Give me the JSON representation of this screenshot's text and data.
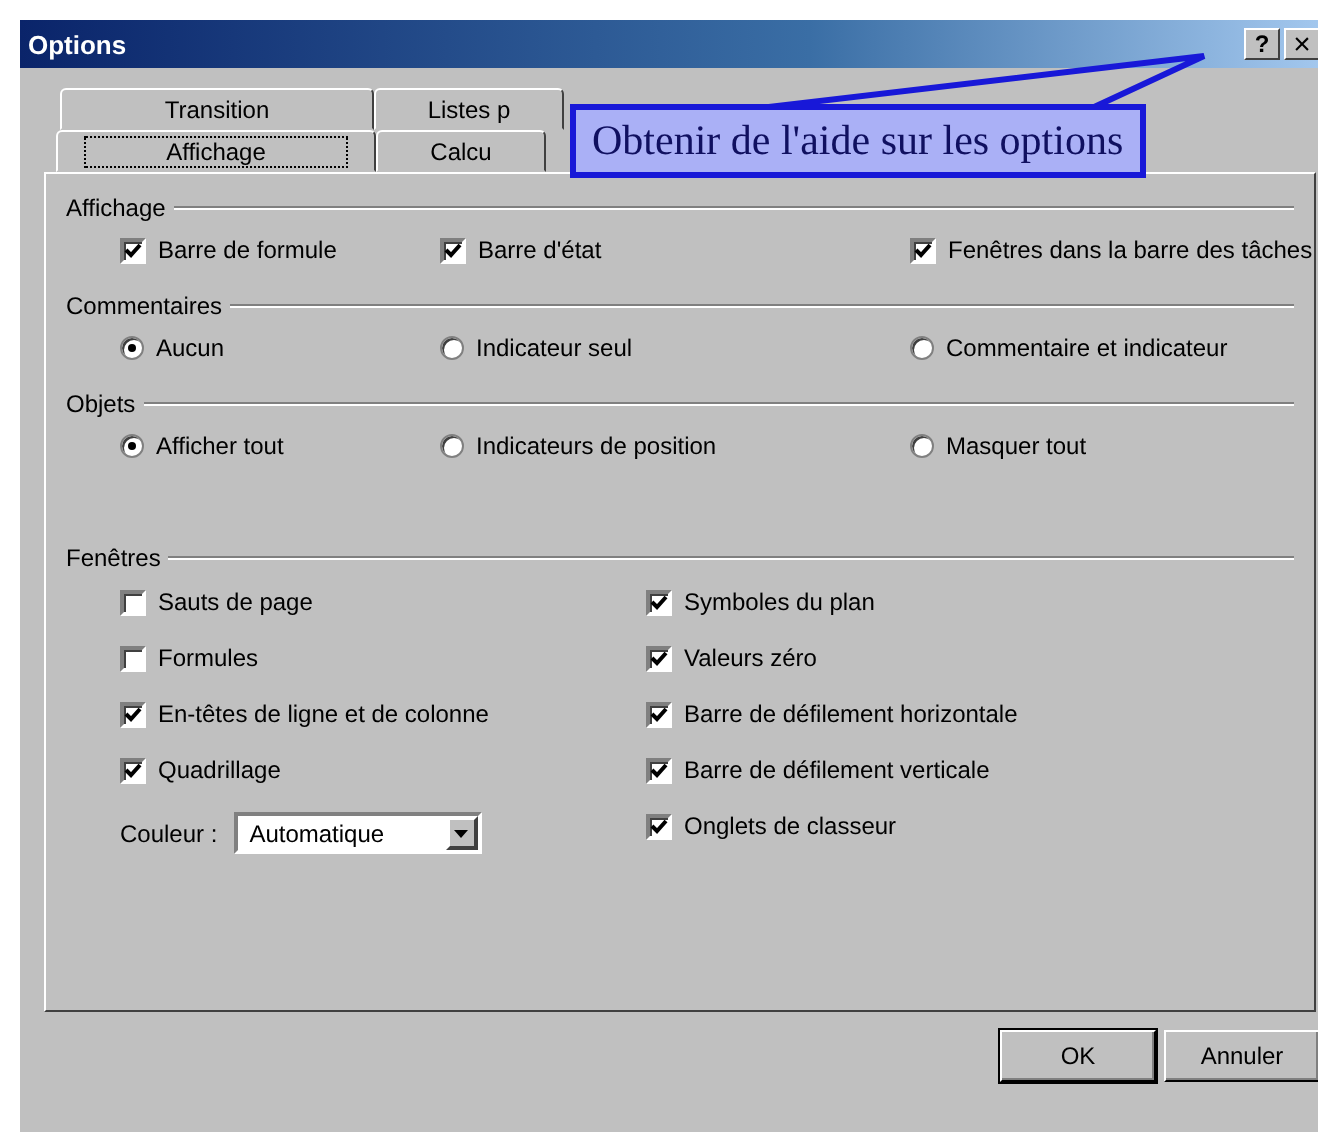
{
  "window": {
    "title": "Options",
    "controls": [
      {
        "kind": "help",
        "label": "?"
      },
      {
        "kind": "close",
        "label": "×"
      }
    ]
  },
  "callout": {
    "text": "Obtenir de l'aide sur les options"
  },
  "tab_rows": [
    [
      {
        "label": "Transition",
        "selected": false
      },
      {
        "label": "Listes p",
        "selected": false
      }
    ],
    [
      {
        "label": "Affichage",
        "selected": true
      },
      {
        "label": "Calcu",
        "selected": false
      }
    ]
  ],
  "sections": [
    {
      "kind": "checks",
      "title": "Affichage",
      "items": [
        {
          "label": "Barre de formule",
          "checked": true
        },
        {
          "label": "Barre d'état",
          "checked": true
        },
        {
          "label": "Fenêtres dans la barre des tâches",
          "checked": true
        }
      ]
    },
    {
      "kind": "radios",
      "title": "Commentaires",
      "items": [
        {
          "label": "Aucun",
          "selected": true
        },
        {
          "label": "Indicateur seul",
          "selected": false
        },
        {
          "label": "Commentaire et indicateur",
          "selected": false
        }
      ]
    },
    {
      "kind": "radios",
      "title": "Objets",
      "items": [
        {
          "label": "Afficher tout",
          "selected": true
        },
        {
          "label": "Indicateurs de position",
          "selected": false
        },
        {
          "label": "Masquer tout",
          "selected": false
        }
      ]
    },
    {
      "kind": "windows",
      "title": "Fenêtres",
      "left": [
        {
          "label": "Sauts de page",
          "checked": false
        },
        {
          "label": "Formules",
          "checked": false
        },
        {
          "label": "En-têtes de ligne et de colonne",
          "checked": true
        },
        {
          "label": "Quadrillage",
          "checked": true
        }
      ],
      "color": {
        "label": "Couleur :",
        "value": "Automatique"
      },
      "right": [
        {
          "label": "Symboles du plan",
          "checked": true
        },
        {
          "label": "Valeurs zéro",
          "checked": true
        },
        {
          "label": "Barre de défilement horizontale",
          "checked": true
        },
        {
          "label": "Barre de défilement verticale",
          "checked": true
        },
        {
          "label": "Onglets de classeur",
          "checked": true
        }
      ]
    }
  ],
  "buttons": [
    {
      "label": "OK"
    },
    {
      "label": "Annuler"
    }
  ]
}
